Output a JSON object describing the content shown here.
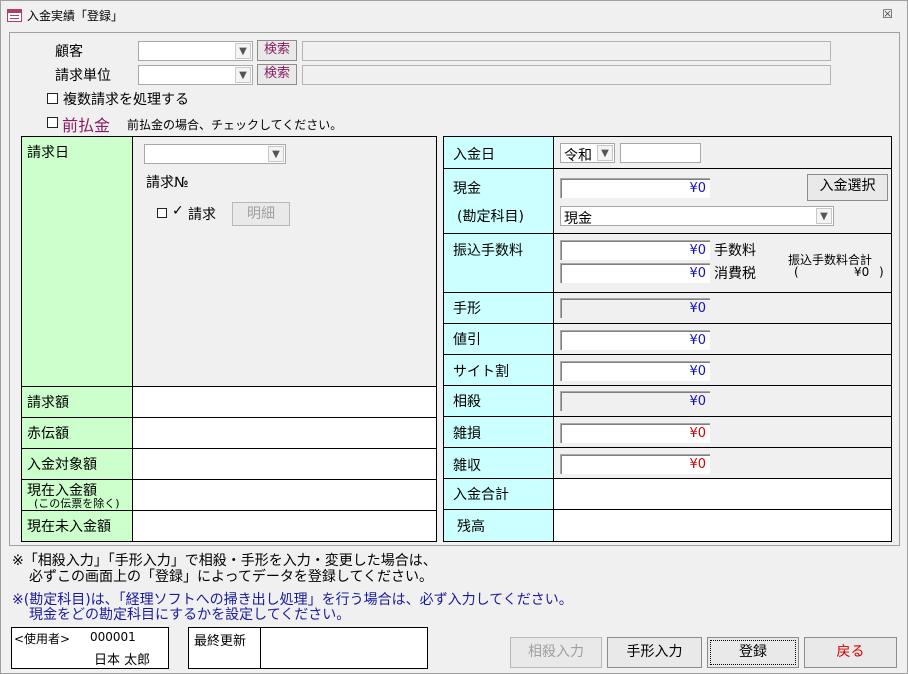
{
  "window": {
    "title": "入金実績「登録」",
    "close_glyph": "☒"
  },
  "header": {
    "customer_label": "顧客",
    "billing_unit_label": "請求単位",
    "search_label": "検索",
    "multi_invoice_label": "複数請求を処理する",
    "prepayment_label": "前払金",
    "prepayment_note": "前払金の場合、チェックしてください。"
  },
  "left": {
    "invoice_date_label": "請求日",
    "invoice_no_label": "請求№",
    "invoice_check_label": "請求",
    "detail_button": "明細",
    "rows": [
      {
        "label": "請求額"
      },
      {
        "label": "赤伝額"
      },
      {
        "label": "入金対象額"
      },
      {
        "label": "現在入金額",
        "sublabel": "(この伝票を除く)"
      },
      {
        "label": "現在未入金額"
      }
    ]
  },
  "right": {
    "payment_date_label": "入金日",
    "era_value": "令和",
    "cash_label": "現金",
    "account_label": "(勘定科目)",
    "account_value": "現金",
    "select_payment_button": "入金選択",
    "transfer_fee_label": "振込手数料",
    "fee_label": "手数料",
    "tax_label": "消費税",
    "fee_total_label": "振込手数料合計",
    "fee_total_open": "(",
    "fee_total_value": "¥0",
    "fee_total_close": ")",
    "bill_label": "手形",
    "discount_label": "値引",
    "site_discount_label": "サイト割",
    "offset_label": "相殺",
    "misc_loss_label": "雑損",
    "misc_income_label": "雑収",
    "payment_total_label": "入金合計",
    "balance_label": "残高",
    "zero": "¥0"
  },
  "notes": {
    "line1": "※「相殺入力」「手形入力」で相殺・手形を入力・変更した場合は、",
    "line2": "必ずこの画面上の「登録」によってデータを登録してください。",
    "line3": "※(勘定科目)は、「経理ソフトへの掃き出し処理」を行う場合は、必ず入力してください。",
    "line4": "現金をどの勘定科目にするかを設定してください。"
  },
  "footer": {
    "user_label": "<使用者>",
    "user_code": "000001",
    "user_name": "日本 太郎",
    "last_update_label": "最終更新",
    "offset_input_button": "相殺入力",
    "bill_input_button": "手形入力",
    "register_button": "登録",
    "back_button": "戻る"
  },
  "colors": {
    "green": "#ccffcc",
    "cyan": "#ccffff",
    "amount_blue": "#1010c0",
    "amount_red": "#d00000",
    "link_purple": "#8b1c62"
  }
}
